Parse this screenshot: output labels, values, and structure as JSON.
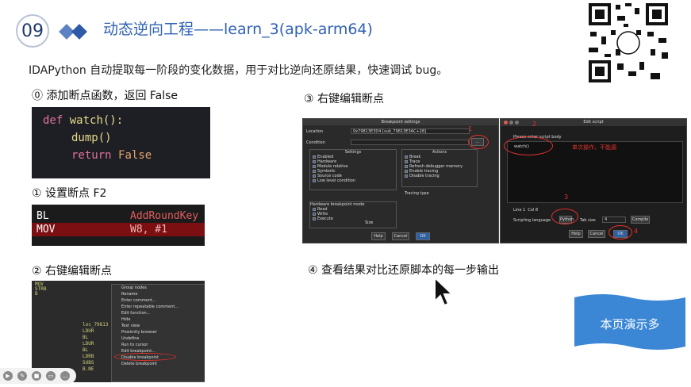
{
  "header": {
    "number": "09",
    "title": "动态逆向工程——learn_3(apk-arm64)"
  },
  "subtitle": "IDAPython 自动提取每一阶段的变化数据，用于对比逆向还原结果，快速调试 bug。",
  "steps": {
    "s0": "⓪ 添加断点函数，返回 False",
    "s1": "① 设置断点 F2",
    "s2": "② 右键编辑断点",
    "s3": "③ 右键编辑断点",
    "s4": "④ 查看结果对比还原脚本的每一步输出"
  },
  "code": {
    "l1_kw": "def",
    "l1_fn": "watch():",
    "l2": "dump()",
    "l3_kw": "return",
    "l3_val": "False"
  },
  "asm": [
    {
      "op": "BL",
      "arg": "AddRoundKey"
    },
    {
      "op": "MOV",
      "arg": "W8, #1"
    }
  ],
  "ctx_menu": [
    "Group nodes",
    "Rename",
    "Enter comment...",
    "Enter repeatable comment...",
    "Edit function...",
    "Hide",
    "Text view",
    "Proximity browser",
    "Undefine",
    "Run to cursor",
    "Edit breakpoint...",
    "Disable breakpoint",
    "Delete breakpoint"
  ],
  "ctx_code": [
    "MOV",
    "STRB",
    "B",
    "loc_79813",
    "LDUR",
    "BL",
    "LDUR",
    "BL",
    "LDRB",
    "SUBS",
    "B.NE"
  ],
  "bp_dialog": {
    "title": "Breakpoint settings",
    "location_label": "Location",
    "location_value": "0x79813E3D4 [sub_79813E3AC+28]",
    "condition_label": "Condition",
    "ellipsis": "...",
    "settings_title": "Settings",
    "settings": [
      "Enabled",
      "Hardware",
      "Module relative",
      "Symbolic",
      "Source code",
      "Low level condition"
    ],
    "actions_title": "Actions",
    "actions": [
      "Break",
      "Trace",
      "Refresh debugger memory",
      "Enable tracing",
      "Disable tracing"
    ],
    "tracing_type": "Tracing type",
    "hw_mode": "Hardware breakpoint mode",
    "hw": [
      "Read",
      "Write",
      "Execute"
    ],
    "size": "Size",
    "buttons": [
      "Help",
      "Cancel",
      "OK"
    ]
  },
  "script_dialog": {
    "title": "Edit script",
    "hint": "Please enter script body",
    "body": "watch()",
    "note": "单次操作，不能漏",
    "lang_label": "Scripting language",
    "lang": "Python",
    "tab_label": "Tab size",
    "tab": "4",
    "compile": "Compile",
    "line": "Line 1",
    "col": "Col 8",
    "buttons": [
      "Help",
      "Cancel",
      "OK"
    ]
  },
  "markers": [
    "1",
    "2",
    "3",
    "4"
  ],
  "banner": "本页演示多",
  "colors": {
    "title": "#2f62b5",
    "banner": "#3b87d6",
    "red": "#e2312b"
  }
}
